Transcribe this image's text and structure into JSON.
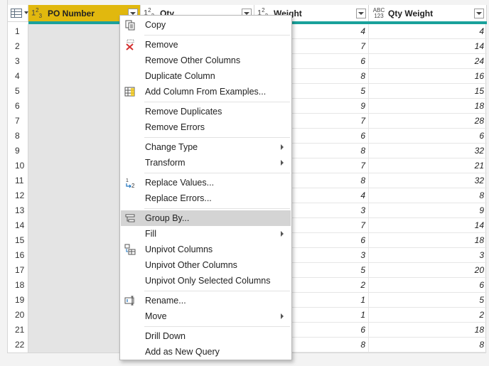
{
  "columns": [
    {
      "type_top": "1",
      "type_bottom": "2",
      "type_sub": "3",
      "label": "PO Number"
    },
    {
      "type_top": "1",
      "type_bottom": "2",
      "type_sub": "3",
      "label": "Qty"
    },
    {
      "type_top": "1",
      "type_bottom": "2",
      "type_sub": "3",
      "label": "Weight"
    },
    {
      "type_top": "ABC",
      "type_bottom": "123",
      "label": "Qty Weight"
    }
  ],
  "rows": [
    {
      "n": "1",
      "weight": "4",
      "qty_weight": "4"
    },
    {
      "n": "2",
      "weight": "7",
      "qty_weight": "14"
    },
    {
      "n": "3",
      "weight": "6",
      "qty_weight": "24"
    },
    {
      "n": "4",
      "weight": "8",
      "qty_weight": "16"
    },
    {
      "n": "5",
      "weight": "5",
      "qty_weight": "15"
    },
    {
      "n": "6",
      "weight": "9",
      "qty_weight": "18"
    },
    {
      "n": "7",
      "weight": "7",
      "qty_weight": "28"
    },
    {
      "n": "8",
      "weight": "6",
      "qty_weight": "6"
    },
    {
      "n": "9",
      "weight": "8",
      "qty_weight": "32"
    },
    {
      "n": "10",
      "weight": "7",
      "qty_weight": "21"
    },
    {
      "n": "11",
      "weight": "8",
      "qty_weight": "32"
    },
    {
      "n": "12",
      "weight": "4",
      "qty_weight": "8"
    },
    {
      "n": "13",
      "weight": "3",
      "qty_weight": "9"
    },
    {
      "n": "14",
      "weight": "7",
      "qty_weight": "14"
    },
    {
      "n": "15",
      "weight": "6",
      "qty_weight": "18"
    },
    {
      "n": "16",
      "weight": "3",
      "qty_weight": "3"
    },
    {
      "n": "17",
      "weight": "5",
      "qty_weight": "20"
    },
    {
      "n": "18",
      "weight": "2",
      "qty_weight": "6"
    },
    {
      "n": "19",
      "weight": "1",
      "qty_weight": "5"
    },
    {
      "n": "20",
      "weight": "1",
      "qty_weight": "2"
    },
    {
      "n": "21",
      "weight": "6",
      "qty_weight": "18"
    },
    {
      "n": "22",
      "weight": "8",
      "qty_weight": "8"
    }
  ],
  "menu": [
    {
      "label": "Copy",
      "icon": "copy-icon"
    },
    {
      "sep": true
    },
    {
      "label": "Remove",
      "icon": "remove-icon"
    },
    {
      "label": "Remove Other Columns"
    },
    {
      "label": "Duplicate Column"
    },
    {
      "label": "Add Column From Examples...",
      "icon": "add-column-examples-icon"
    },
    {
      "sep": true
    },
    {
      "label": "Remove Duplicates"
    },
    {
      "label": "Remove Errors"
    },
    {
      "sep": true
    },
    {
      "label": "Change Type",
      "submenu": true
    },
    {
      "label": "Transform",
      "submenu": true
    },
    {
      "sep": true
    },
    {
      "label": "Replace Values...",
      "icon": "replace-values-icon"
    },
    {
      "label": "Replace Errors..."
    },
    {
      "sep": true
    },
    {
      "label": "Group By...",
      "icon": "group-by-icon",
      "highlighted": true
    },
    {
      "label": "Fill",
      "submenu": true
    },
    {
      "label": "Unpivot Columns",
      "icon": "unpivot-icon"
    },
    {
      "label": "Unpivot Other Columns"
    },
    {
      "label": "Unpivot Only Selected Columns"
    },
    {
      "sep": true
    },
    {
      "label": "Rename...",
      "icon": "rename-icon"
    },
    {
      "label": "Move",
      "submenu": true
    },
    {
      "sep": true
    },
    {
      "label": "Drill Down"
    },
    {
      "label": "Add as New Query"
    }
  ],
  "colors": {
    "selected_header": "#e1b80e",
    "quality_bar": "#1aa19b",
    "menu_highlight": "#d4d4d4"
  }
}
